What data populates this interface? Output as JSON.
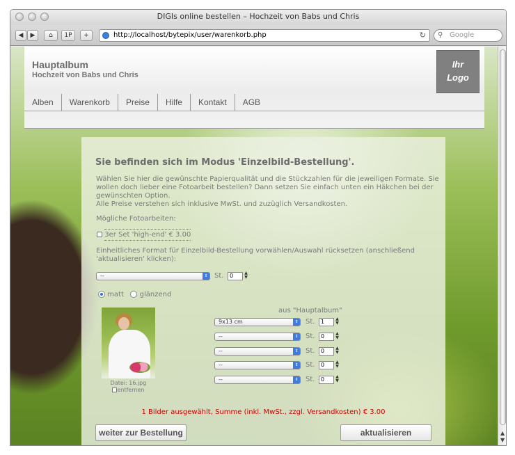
{
  "browser": {
    "window_title": "DIGIs online bestellen – Hochzeit von Babs und Chris",
    "url": "http://localhost/bytepix/user/warenkorb.php",
    "search_placeholder": "Google",
    "back_label": "◀",
    "forward_label": "▶",
    "home_label": "⌂",
    "p_label": "1P",
    "add_label": "+",
    "reload_label": "↻"
  },
  "header": {
    "title": "Hauptalbum",
    "subtitle": "Hochzeit von Babs und Chris",
    "logo_line1": "Ihr",
    "logo_line2": "Logo"
  },
  "nav": {
    "items": [
      "Alben",
      "Warenkorb",
      "Preise",
      "Hilfe",
      "Kontakt",
      "AGB"
    ]
  },
  "content": {
    "heading": "Sie befinden sich im Modus 'Einzelbild-Bestellung'.",
    "intro_line1": "Wählen Sie hier die gewünschte Papierqualität und die Stückzahlen für die jeweiligen Formate. Sie",
    "intro_line2": "wollen doch lieber eine Fotoarbeit bestellen? Dann setzen Sie einfach unten ein Häkchen bei der",
    "intro_line3": "gewünschten Option.",
    "intro_line4": "Alle Preise verstehen sich inklusive MwSt. und zuzüglich Versandkosten.",
    "possible_label": "Mögliche Fotoarbeiten:",
    "set_option": "3er Set 'high-end' € 3.00",
    "format_line1": "Einheitliches Format für Einzelbild-Bestellung vorwählen/Auswahl rücksetzen (anschließend",
    "format_line2": "'aktualisieren' klicken):",
    "global_select_value": "--",
    "st_label": "St.",
    "global_qty": "0",
    "finish_matt": "matt",
    "finish_glossy": "glänzend",
    "from_album": "aus \"Hauptalbum\"",
    "file_caption": "Datei: 16.jpg",
    "remove_label": "entfernen",
    "format_rows": [
      {
        "format": "9x13 cm",
        "qty": "1"
      },
      {
        "format": "--",
        "qty": "0"
      },
      {
        "format": "--",
        "qty": "0"
      },
      {
        "format": "--",
        "qty": "0"
      },
      {
        "format": "--",
        "qty": "0"
      }
    ],
    "summary": "1 Bilder ausgewählt, Summe (inkl. MwSt., zzgl. Versandkosten) € 3.00",
    "continue_button": "weiter zur Bestellung",
    "update_button": "aktualisieren"
  }
}
